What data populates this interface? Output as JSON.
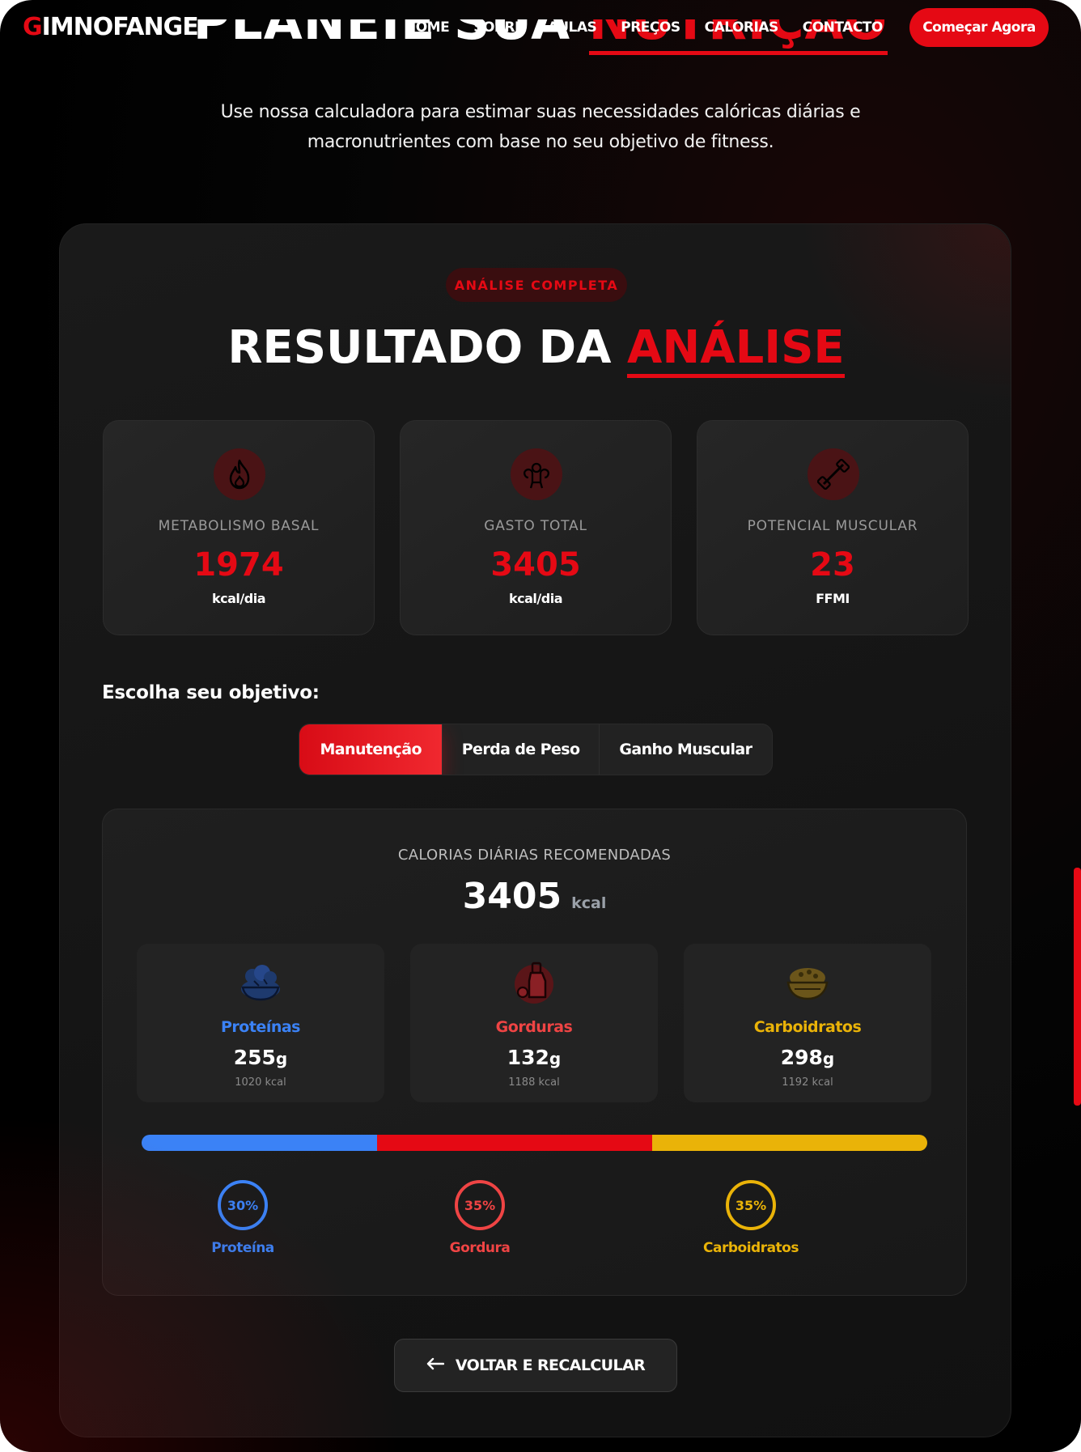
{
  "nav": {
    "logo_first": "G",
    "logo_rest": "IMNOFANGE",
    "links": [
      "HOME",
      "SOBRE",
      "AULAS",
      "PREÇOS",
      "CALORIAS",
      "CONTACTO"
    ],
    "cta": "Começar Agora"
  },
  "hero": {
    "title_white": "PLANEIE SUA",
    "title_red": "NUTRIÇÃO",
    "subtitle_line1": "Use nossa calculadora para estimar suas necessidades calóricas diárias e",
    "subtitle_line2": "macronutrientes com base no seu objetivo de fitness."
  },
  "result": {
    "badge": "ANÁLISE COMPLETA",
    "title_white": "RESULTADO DA",
    "title_red": "ANÁLISE",
    "stats": [
      {
        "icon": "fire-icon",
        "label": "METABOLISMO BASAL",
        "value": "1974",
        "unit": "kcal/dia"
      },
      {
        "icon": "muscle-icon",
        "label": "GASTO TOTAL",
        "value": "3405",
        "unit": "kcal/dia"
      },
      {
        "icon": "dumbbell-icon",
        "label": "POTENCIAL MUSCULAR",
        "value": "23",
        "unit": "FFMI"
      }
    ]
  },
  "goal": {
    "label": "Escolha seu objetivo:",
    "tabs": [
      "Manutenção",
      "Perda de Peso",
      "Ganho Muscular"
    ],
    "active": "Manutenção"
  },
  "recommendation": {
    "label": "CALORIAS DIÁRIAS RECOMENDADAS",
    "value": "3405",
    "unit": "kcal",
    "macros": [
      {
        "icon": "salad-icon",
        "name": "Proteínas",
        "grams": "255",
        "unit": "g",
        "kcal": "1020 kcal",
        "color": "#3b82f6"
      },
      {
        "icon": "oil-icon",
        "name": "Gorduras",
        "grams": "132",
        "unit": "g",
        "kcal": "1188 kcal",
        "color": "#ef4444"
      },
      {
        "icon": "bread-bowl-icon",
        "name": "Carboidratos",
        "grams": "298",
        "unit": "g",
        "kcal": "1192 kcal",
        "color": "#eab308"
      }
    ],
    "distribution": [
      {
        "name": "Proteína",
        "percent": "30%",
        "fraction": 0.3,
        "color": "#3b82f6"
      },
      {
        "name": "Gordura",
        "percent": "35%",
        "fraction": 0.35,
        "color": "#e50914"
      },
      {
        "name": "Carboidratos",
        "percent": "35%",
        "fraction": 0.35,
        "color": "#eab308"
      }
    ]
  },
  "back_button": "VOLTAR E RECALCULAR",
  "colors": {
    "accent": "#e50914",
    "protein": "#3b82f6",
    "fat": "#ef4444",
    "carbs": "#eab308"
  }
}
